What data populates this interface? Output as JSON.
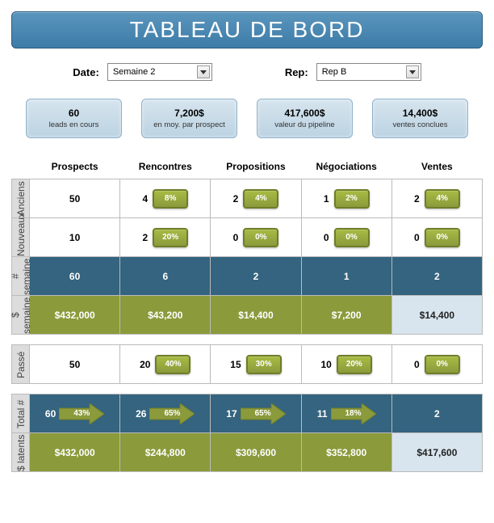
{
  "title": "TABLEAU DE BORD",
  "filters": {
    "date_label": "Date:",
    "date_value": "Semaine 2",
    "rep_label": "Rep:",
    "rep_value": "Rep B"
  },
  "kpis": [
    {
      "value": "60",
      "label": "leads en cours"
    },
    {
      "value": "7,200$",
      "label": "en moy. par prospect"
    },
    {
      "value": "417,600$",
      "label": "valeur du pipeline"
    },
    {
      "value": "14,400$",
      "label": "ventes conclues"
    }
  ],
  "columns": [
    "Prospects",
    "Rencontres",
    "Propositions",
    "Négociations",
    "Ventes"
  ],
  "rows": {
    "anciens_label": "Anciens",
    "anciens": [
      {
        "n": "50"
      },
      {
        "n": "4",
        "pct": "8%"
      },
      {
        "n": "2",
        "pct": "4%"
      },
      {
        "n": "1",
        "pct": "2%"
      },
      {
        "n": "2",
        "pct": "4%"
      }
    ],
    "nouveaux_label": "Nouveaux",
    "nouveaux": [
      {
        "n": "10"
      },
      {
        "n": "2",
        "pct": "20%"
      },
      {
        "n": "0",
        "pct": "0%"
      },
      {
        "n": "0",
        "pct": "0%"
      },
      {
        "n": "0",
        "pct": "0%"
      }
    ],
    "count_label": "# semaine",
    "count": [
      "60",
      "6",
      "2",
      "1",
      "2"
    ],
    "money_label": "$ semaine",
    "money": [
      "$432,000",
      "$43,200",
      "$14,400",
      "$7,200",
      "$14,400"
    ],
    "passe_label": "Passé",
    "passe": [
      {
        "n": "50"
      },
      {
        "n": "20",
        "pct": "40%"
      },
      {
        "n": "15",
        "pct": "30%"
      },
      {
        "n": "10",
        "pct": "20%"
      },
      {
        "n": "0",
        "pct": "0%"
      }
    ],
    "total_label": "Total #",
    "total": [
      {
        "n": "60",
        "arrow": "43%"
      },
      {
        "n": "26",
        "arrow": "65%"
      },
      {
        "n": "17",
        "arrow": "65%"
      },
      {
        "n": "11",
        "arrow": "18%"
      },
      {
        "n": "2"
      }
    ],
    "latents_label": "$ latents",
    "latents": [
      "$432,000",
      "$244,800",
      "$309,600",
      "$352,800",
      "$417,600"
    ]
  }
}
